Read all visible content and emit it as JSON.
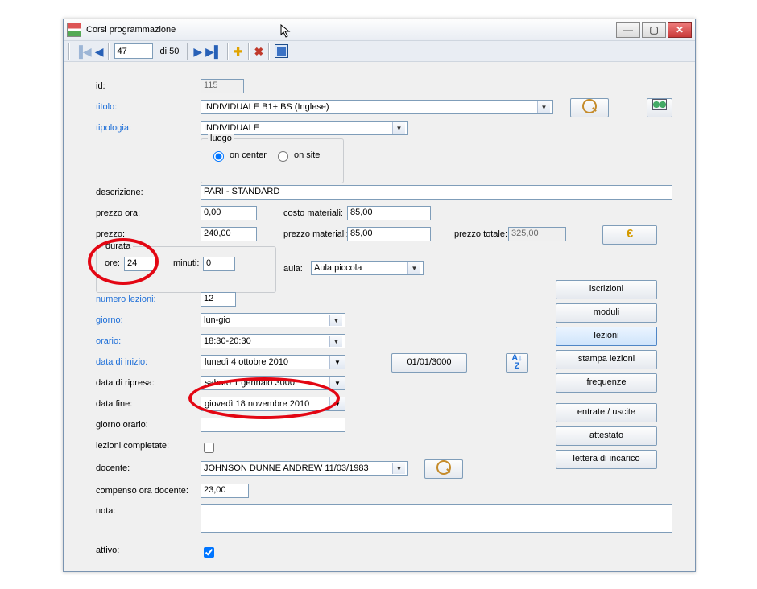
{
  "window": {
    "title": "Corsi programmazione"
  },
  "nav": {
    "position": "47",
    "total_label": "di 50"
  },
  "labels": {
    "id": "id:",
    "titolo": "titolo:",
    "tipologia": "tipologia:",
    "luogo": "luogo",
    "on_center": "on center",
    "on_site": "on site",
    "descrizione": "descrizione:",
    "prezzo_ora": "prezzo ora:",
    "costo_materiali": "costo materiali:",
    "prezzo": "prezzo:",
    "prezzo_materiali": "prezzo materiali:",
    "prezzo_totale": "prezzo totale:",
    "durata": "durata",
    "ore": "ore:",
    "minuti": "minuti:",
    "aula": "aula:",
    "numero_lezioni": "numero lezioni:",
    "giorno": "giorno:",
    "orario": "orario:",
    "data_inizio": "data di inizio:",
    "data_ripresa": "data di ripresa:",
    "data_fine": "data fine:",
    "giorno_orario": "giorno orario:",
    "lezioni_completate": "lezioni completate:",
    "docente": "docente:",
    "compenso_ora_docente": "compenso ora docente:",
    "nota": "nota:",
    "attivo": "attivo:"
  },
  "values": {
    "id": "115",
    "titolo": "INDIVIDUALE B1+ BS (Inglese)",
    "tipologia": "INDIVIDUALE",
    "descrizione": "PARI - STANDARD",
    "prezzo_ora": "0,00",
    "costo_materiali": "85,00",
    "prezzo": "240,00",
    "prezzo_materiali": "85,00",
    "prezzo_totale": "325,00",
    "ore": "24",
    "minuti": "0",
    "aula": "Aula piccola",
    "numero_lezioni": "12",
    "giorno": "lun-gio",
    "orario": "18:30-20:30",
    "data_inizio": "lunedì     4   ottobre    2010",
    "data_ripresa": "sabato     1   gennaio    3000",
    "data_fine": "giovedì  18 novembre 2010",
    "giorno_orario": "",
    "docente": "JOHNSON DUNNE ANDREW 11/03/1983",
    "compenso_ora_docente": "23,00",
    "nota": "",
    "btn_date_3000": "01/01/3000"
  },
  "side_buttons": {
    "iscrizioni": "iscrizioni",
    "moduli": "moduli",
    "lezioni": "lezioni",
    "stampa_lezioni": "stampa lezioni",
    "frequenze": "frequenze",
    "entrate_uscite": "entrate / uscite",
    "attestato": "attestato",
    "lettera_incarico": "lettera di incarico"
  }
}
